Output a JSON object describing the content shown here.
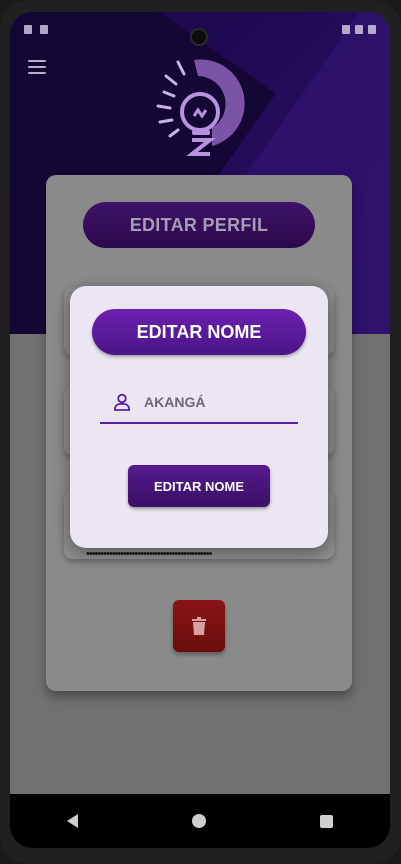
{
  "profile": {
    "title": "EDITAR PERFIL",
    "password_mask": "••••••••••••••••••••••••••••••••••••••••••••"
  },
  "dialog": {
    "title": "EDITAR NOME",
    "name_input": {
      "value": "AKANGÁ",
      "placeholder": "AKANGÁ"
    },
    "submit_label": "EDITAR NOME"
  },
  "icons": {
    "menu": "menu-icon",
    "user": "user-icon",
    "trash": "trash-icon",
    "logo": "lightbulb-logo"
  },
  "colors": {
    "accent": "#5a1fa0",
    "danger": "#8a1414",
    "dialog_bg": "#ece6f2"
  }
}
